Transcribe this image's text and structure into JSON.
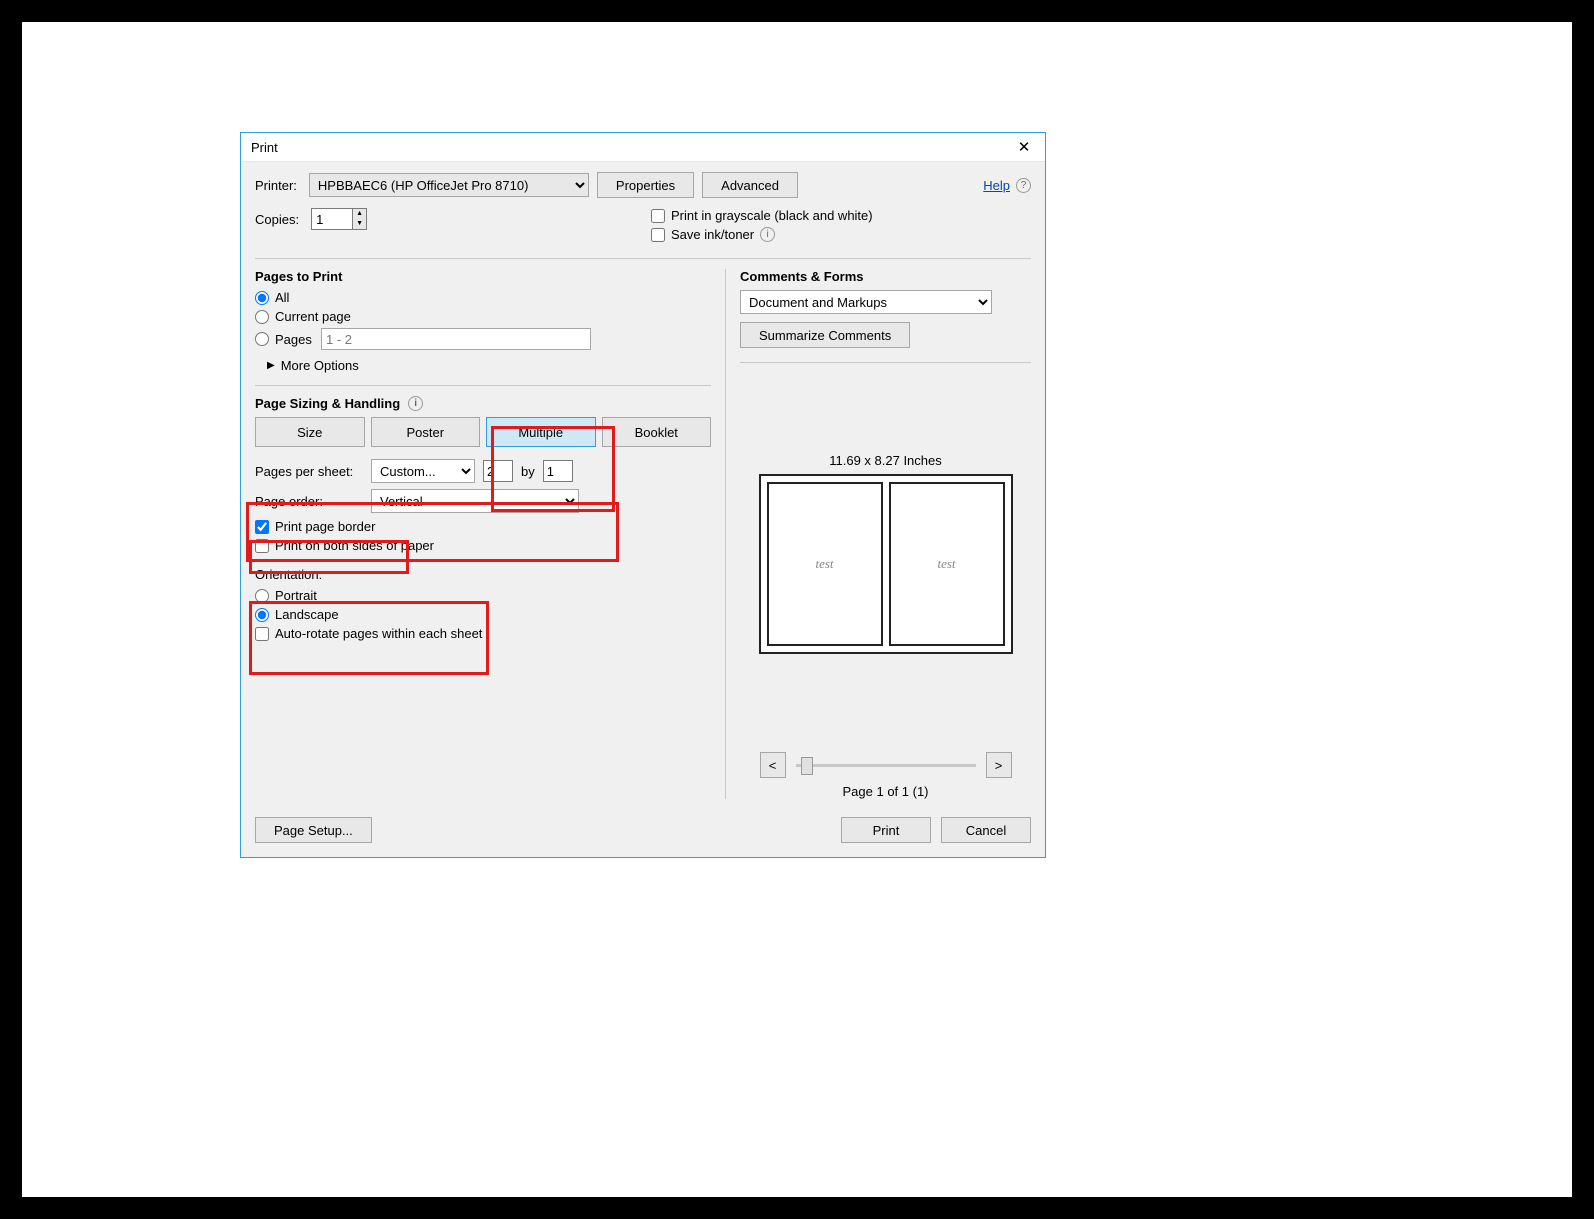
{
  "dialog": {
    "title": "Print"
  },
  "printer": {
    "label": "Printer:",
    "selected": "HPBBAEC6 (HP OfficeJet Pro 8710)",
    "properties_btn": "Properties",
    "advanced_btn": "Advanced"
  },
  "help": {
    "label": "Help"
  },
  "copies": {
    "label": "Copies:",
    "value": "1"
  },
  "checks": {
    "grayscale": "Print in grayscale (black and white)",
    "save_ink": "Save ink/toner"
  },
  "pages_to_print": {
    "heading": "Pages to Print",
    "all": "All",
    "current": "Current page",
    "pages": "Pages",
    "range": "1 - 2",
    "more_options": "More Options"
  },
  "sizing": {
    "heading": "Page Sizing & Handling",
    "tabs": [
      "Size",
      "Poster",
      "Multiple",
      "Booklet"
    ],
    "pages_per_sheet": "Pages per sheet:",
    "pps_mode": "Custom...",
    "pps_x": "2",
    "pps_by": "by",
    "pps_y": "1",
    "page_order_lbl": "Page order:",
    "page_order": "Vertical",
    "print_border": "Print page border",
    "both_sides": "Print on both sides of paper"
  },
  "orientation": {
    "heading": "Orientation:",
    "portrait": "Portrait",
    "landscape": "Landscape",
    "autorotate": "Auto-rotate pages within each sheet"
  },
  "comments": {
    "heading": "Comments & Forms",
    "selected": "Document and Markups",
    "summarize_btn": "Summarize Comments"
  },
  "preview": {
    "dimensions": "11.69 x 8.27 Inches",
    "thumb_text": "test",
    "page_of": "Page 1 of 1 (1)"
  },
  "footer": {
    "page_setup": "Page Setup...",
    "print": "Print",
    "cancel": "Cancel"
  }
}
